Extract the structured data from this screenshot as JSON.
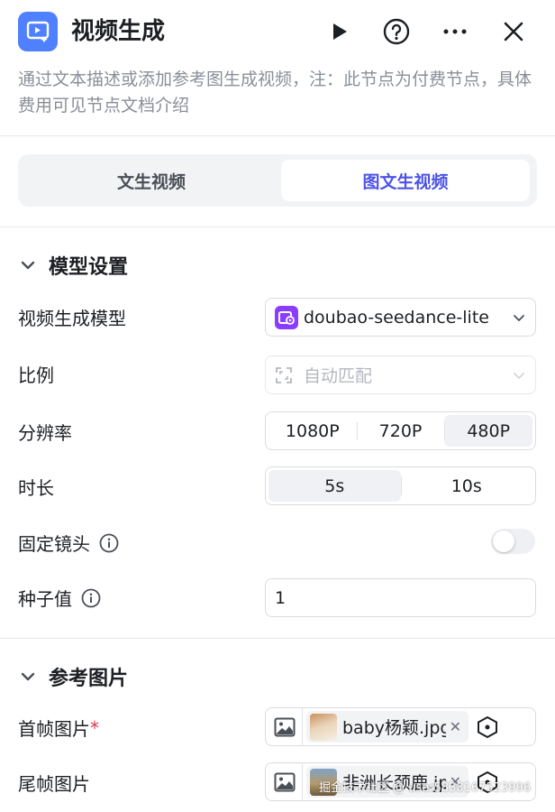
{
  "header": {
    "title": "视频生成",
    "description": "通过文本描述或添加参考图生成视频，注：此节点为付费节点，具体费用可见节点文档介绍",
    "icons": [
      "video-node-icon",
      "play-icon",
      "help-icon",
      "more-icon",
      "close-icon"
    ]
  },
  "tabs": [
    {
      "label": "文生视频",
      "active": false
    },
    {
      "label": "图文生视频",
      "active": true
    }
  ],
  "model_section": {
    "title": "模型设置",
    "model": {
      "label": "视频生成模型",
      "value": "doubao-seedance-lite"
    },
    "ratio": {
      "label": "比例",
      "value": "自动匹配",
      "disabled": true
    },
    "resolution": {
      "label": "分辨率",
      "options": [
        "1080P",
        "720P",
        "480P"
      ],
      "selected": "480P"
    },
    "duration": {
      "label": "时长",
      "options": [
        "5s",
        "10s"
      ],
      "selected": "5s"
    },
    "fixed_camera": {
      "label": "固定镜头",
      "enabled": false
    },
    "seed": {
      "label": "种子值",
      "value": "1"
    }
  },
  "reference_section": {
    "title": "参考图片",
    "first_frame": {
      "label": "首帧图片",
      "required_mark": "*",
      "file": "baby杨颖.jpg"
    },
    "last_frame": {
      "label": "尾帧图片",
      "file": "非洲长颈鹿.jp"
    }
  },
  "watermark": "掘金技术社区 @ user5838167523996",
  "colors": {
    "accent": "#4d53e8",
    "icon_blue": "#4f80ff",
    "model_purple": "#8b3dff",
    "required": "#e0364a"
  }
}
